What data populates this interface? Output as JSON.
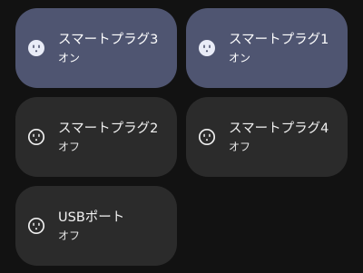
{
  "tiles": [
    {
      "title": "スマートプラグ3",
      "state": "オン",
      "on": true,
      "icon": "outlet-icon"
    },
    {
      "title": "スマートプラグ1",
      "state": "オン",
      "on": true,
      "icon": "outlet-icon"
    },
    {
      "title": "スマートプラグ2",
      "state": "オフ",
      "on": false,
      "icon": "outlet-icon"
    },
    {
      "title": "スマートプラグ4",
      "state": "オフ",
      "on": false,
      "icon": "outlet-icon"
    },
    {
      "title": "USBポート",
      "state": "オフ",
      "on": false,
      "icon": "outlet-icon"
    }
  ],
  "colors": {
    "background": "#121212",
    "tile_on": "#4f5571",
    "tile_off": "#2b2b2b",
    "icon_on_fill": "#e9ecf7",
    "icon_off_stroke": "#eeeeee"
  }
}
